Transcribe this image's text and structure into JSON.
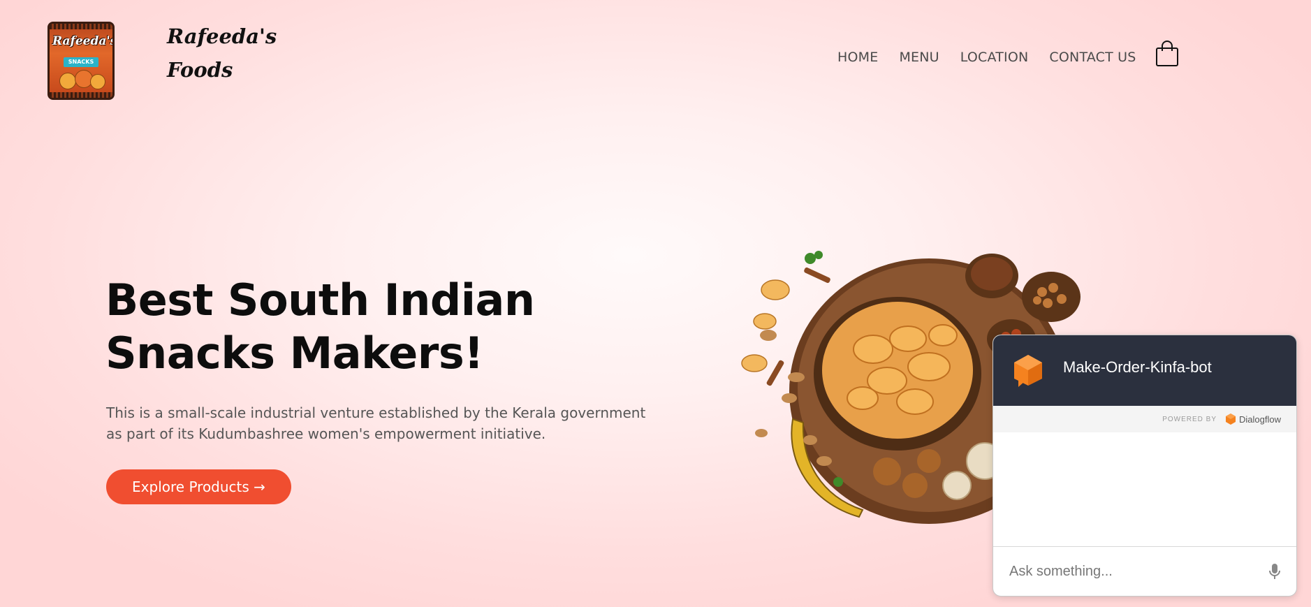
{
  "header": {
    "logo": {
      "brand_text": "Rafeeda's",
      "tag_text": "SNACKS"
    },
    "brand_name_line1": "Rafeeda's",
    "brand_name_line2": "Foods",
    "nav": [
      {
        "label": "HOME"
      },
      {
        "label": "MENU"
      },
      {
        "label": "LOCATION"
      },
      {
        "label": "CONTACT US"
      }
    ],
    "cart_icon": "shopping-bag-icon"
  },
  "hero": {
    "title": "Best South Indian Snacks Makers!",
    "description": "This is a small-scale industrial venture established by the Kerala government as part of its Kudumbashree women's empowerment initiative.",
    "button_label": "Explore Products →",
    "image": "snacks-platter"
  },
  "chat_widget": {
    "title": "Make-Order-Kinfa-bot",
    "icon": "dialogflow-bot-icon",
    "powered_by": "POWERED BY",
    "provider": "Dialogflow",
    "input_placeholder": "Ask something...",
    "mic_icon": "microphone-icon"
  },
  "colors": {
    "accent": "#f04e30",
    "chat_header": "#2b303e",
    "background": "#ffe6e6"
  }
}
